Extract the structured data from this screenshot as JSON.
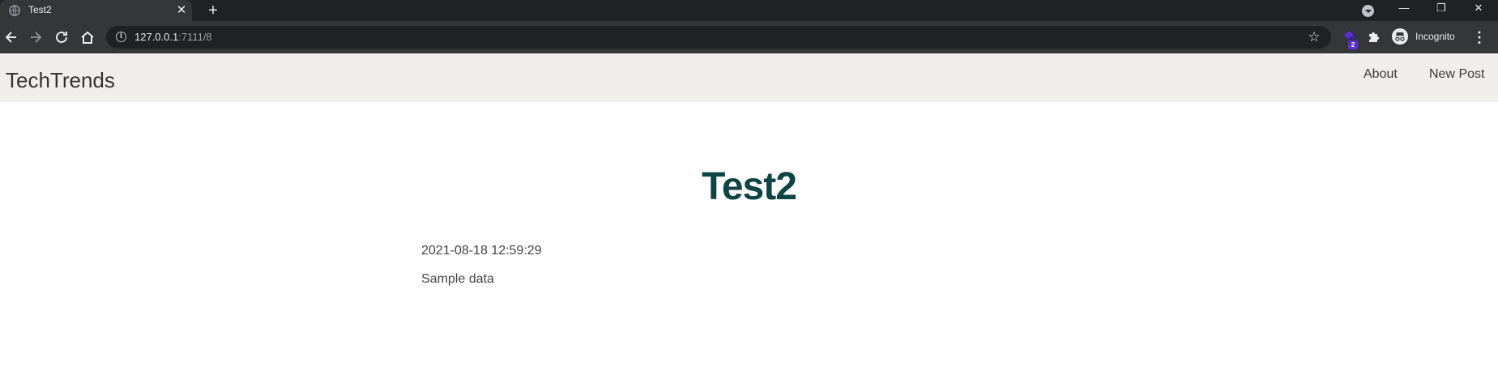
{
  "browser": {
    "tab_title": "Test2",
    "tab_close": "✕",
    "new_tab": "+",
    "url_host": "127.0.0.1",
    "url_path": ":7111/8",
    "extension_badge": "2",
    "profile_label": "Incognito",
    "window_controls": {
      "minimize": "—",
      "restore": "❐",
      "close": "✕"
    },
    "menu": "⋮",
    "star": "☆"
  },
  "navbar": {
    "brand": "TechTrends",
    "links": [
      "About",
      "New Post"
    ]
  },
  "post": {
    "title": "Test2",
    "created": "2021-08-18 12:59:29",
    "content": "Sample data"
  },
  "colors": {
    "tabstrip": "#202124",
    "toolbar": "#35363a",
    "navbar_bg": "#f0eeea",
    "title": "#0f4445"
  }
}
